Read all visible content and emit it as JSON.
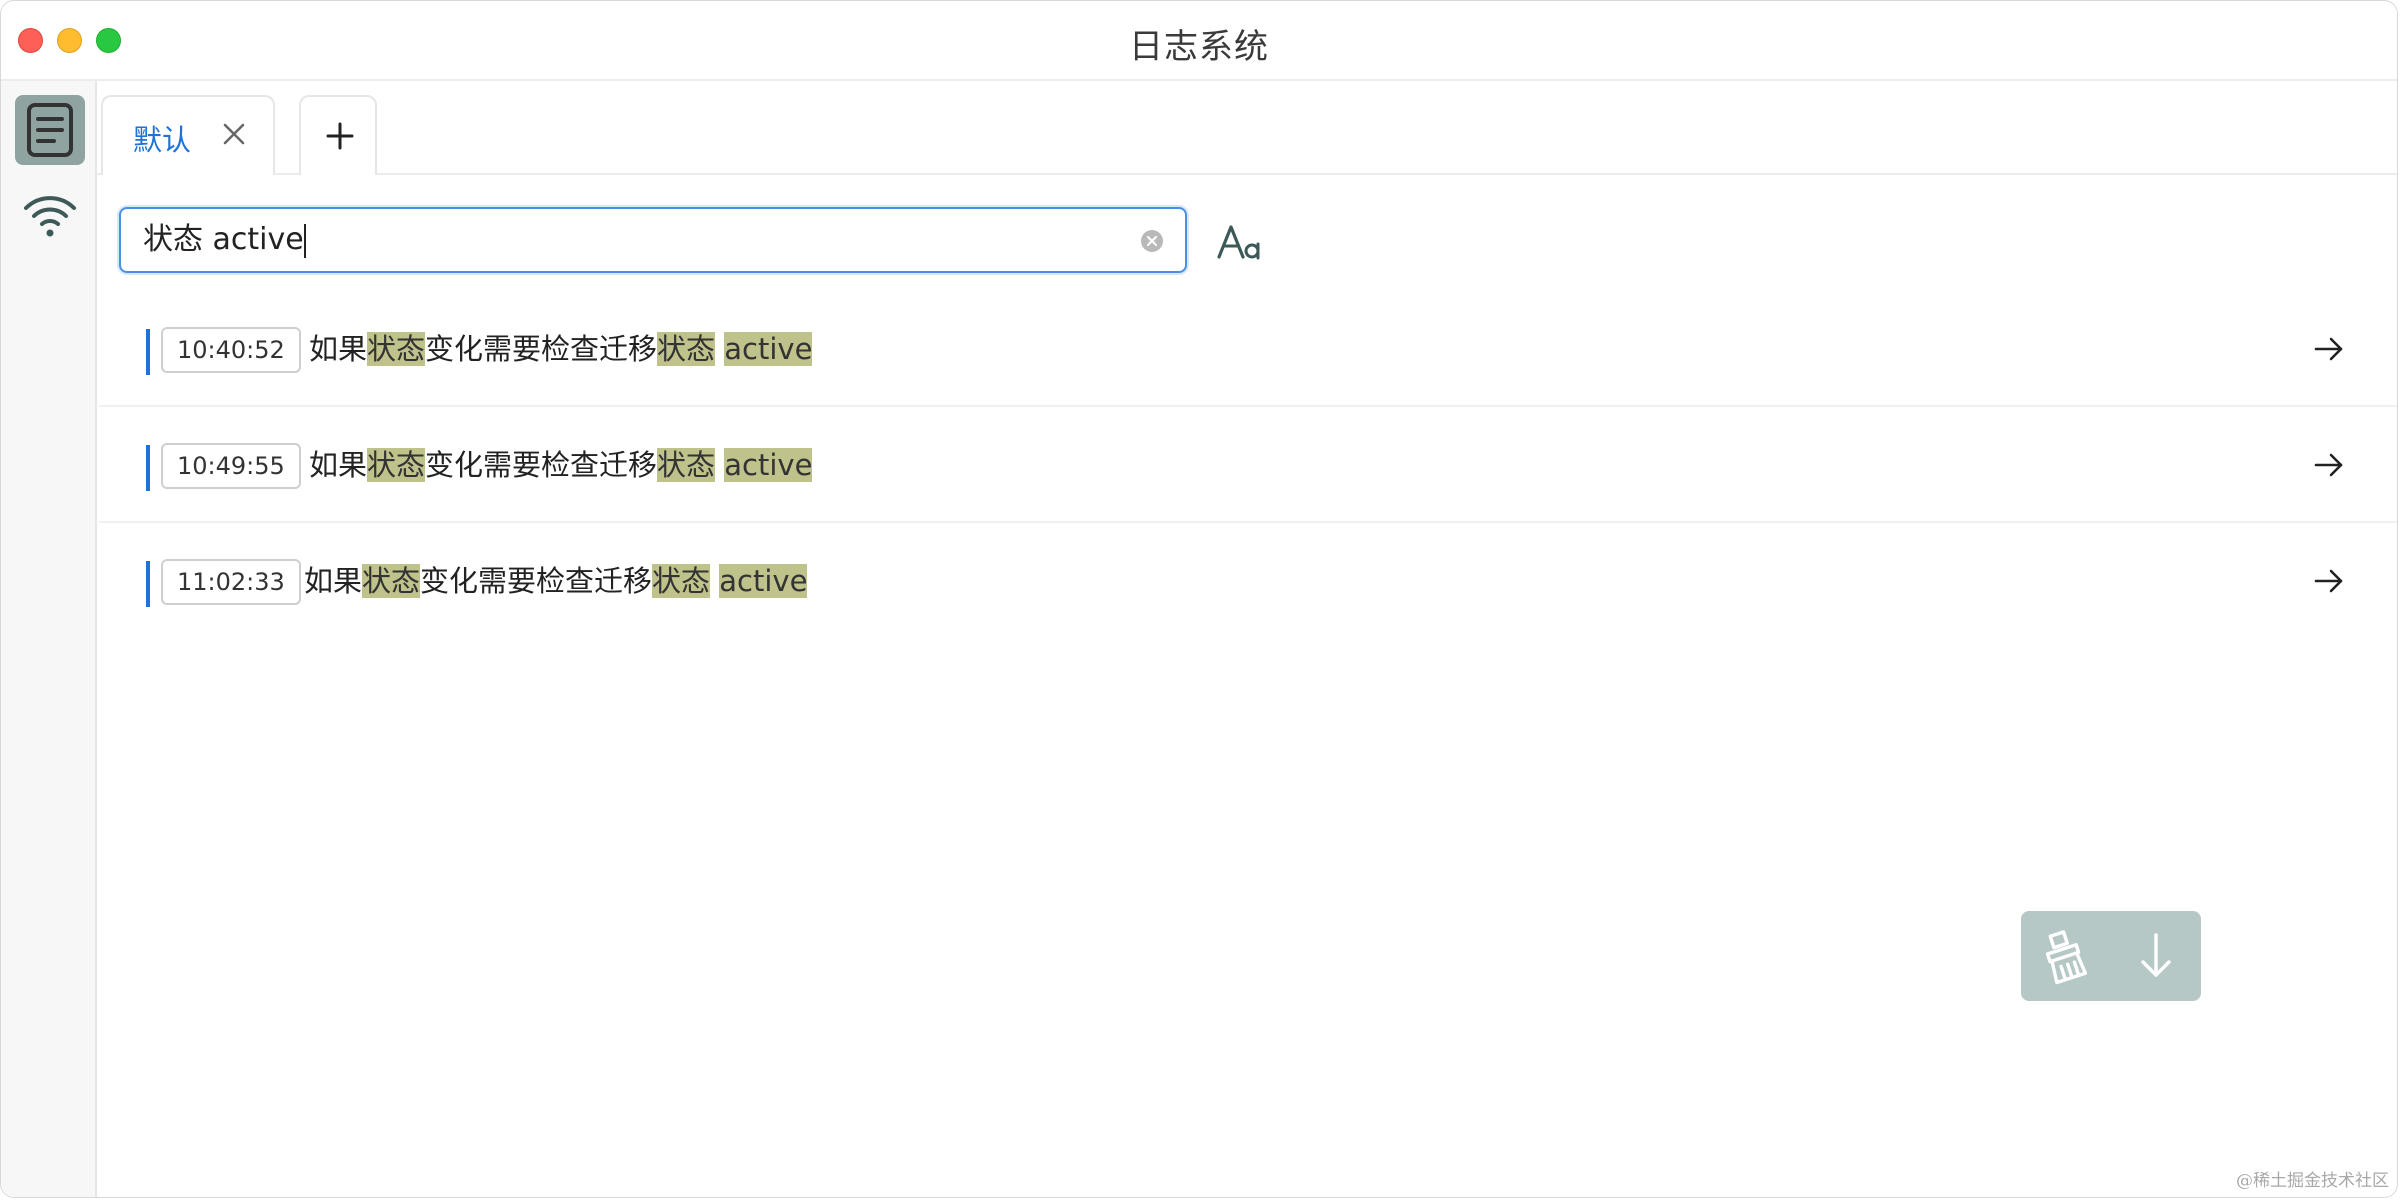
{
  "window": {
    "title": "日志系统"
  },
  "sidebar": {
    "items": [
      {
        "icon": "log-list-icon",
        "active": true
      },
      {
        "icon": "wifi-icon",
        "active": false
      }
    ]
  },
  "tabs": {
    "items": [
      {
        "label": "默认",
        "closable": true,
        "active": true
      }
    ],
    "add_icon": "plus-icon"
  },
  "search": {
    "value": "状态 active",
    "clear_icon": "clear-circle-icon",
    "case_toggle_icon": "match-case-icon"
  },
  "logs": [
    {
      "time": "10:40:52",
      "parts": [
        [
          "如果",
          false
        ],
        [
          "状态",
          true
        ],
        [
          "变化需要检查迁移",
          false
        ],
        [
          "状态",
          true
        ],
        [
          " ",
          false
        ],
        [
          "active",
          true
        ]
      ]
    },
    {
      "time": "10:49:55",
      "parts": [
        [
          "如果",
          false
        ],
        [
          "状态",
          true
        ],
        [
          "变化需要检查迁移",
          false
        ],
        [
          "状态",
          true
        ],
        [
          " ",
          false
        ],
        [
          "active",
          true
        ]
      ]
    },
    {
      "time": "11:02:33",
      "parts": [
        [
          "如果",
          false
        ],
        [
          "状态",
          true
        ],
        [
          "变化需要检查迁移",
          false
        ],
        [
          "状态",
          true
        ],
        [
          " ",
          false
        ],
        [
          "active",
          true
        ]
      ]
    }
  ],
  "floating_actions": {
    "clear_icon": "broom-icon",
    "scroll_icon": "arrow-down-icon"
  },
  "colors": {
    "accent": "#1f72d6",
    "highlight": "#bfc28a",
    "sidebar_active": "#8fa3a0",
    "float_panel": "#b6c8c5"
  },
  "watermark": "@稀土掘金技术社区"
}
